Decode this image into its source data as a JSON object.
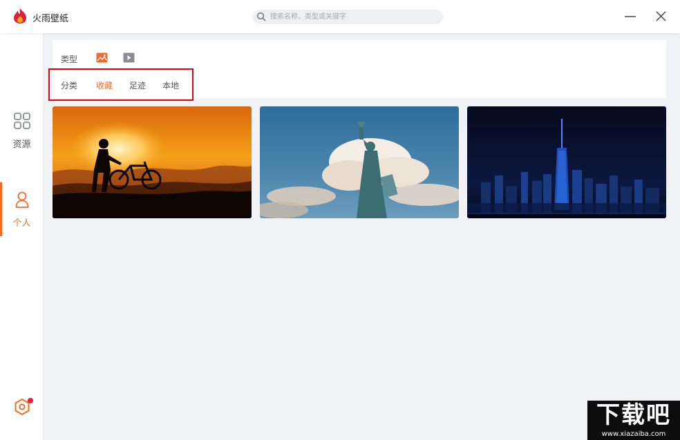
{
  "app": {
    "title": "火雨壁纸",
    "brand_color": "#f06a28"
  },
  "search": {
    "placeholder": "搜索名称、类型或关键字",
    "icon": "search-icon"
  },
  "window_controls": {
    "minimize_icon": "minimize-icon",
    "close_icon": "close-icon"
  },
  "sidebar": {
    "items": [
      {
        "label": "资源",
        "icon": "grid-icon",
        "active": false
      },
      {
        "label": "个人",
        "icon": "user-icon",
        "active": true
      }
    ],
    "settings_icon": "settings-icon",
    "notification_dot_color": "#ee1c46"
  },
  "filter": {
    "type_label": "类型",
    "type_options": [
      {
        "icon": "image-icon",
        "selected": true
      },
      {
        "icon": "video-icon",
        "selected": false
      }
    ],
    "tabs": [
      {
        "label": "分类",
        "active": false
      },
      {
        "label": "收藏",
        "active": true
      },
      {
        "label": "足迹",
        "active": false
      },
      {
        "label": "本地",
        "active": false
      }
    ]
  },
  "wallpapers": [
    {
      "subject": "sunset-cyclist"
    },
    {
      "subject": "statue-of-liberty"
    },
    {
      "subject": "city-skyline-night"
    }
  ],
  "watermark": {
    "text": "下载吧",
    "url": "www.xiazaiba.com"
  }
}
